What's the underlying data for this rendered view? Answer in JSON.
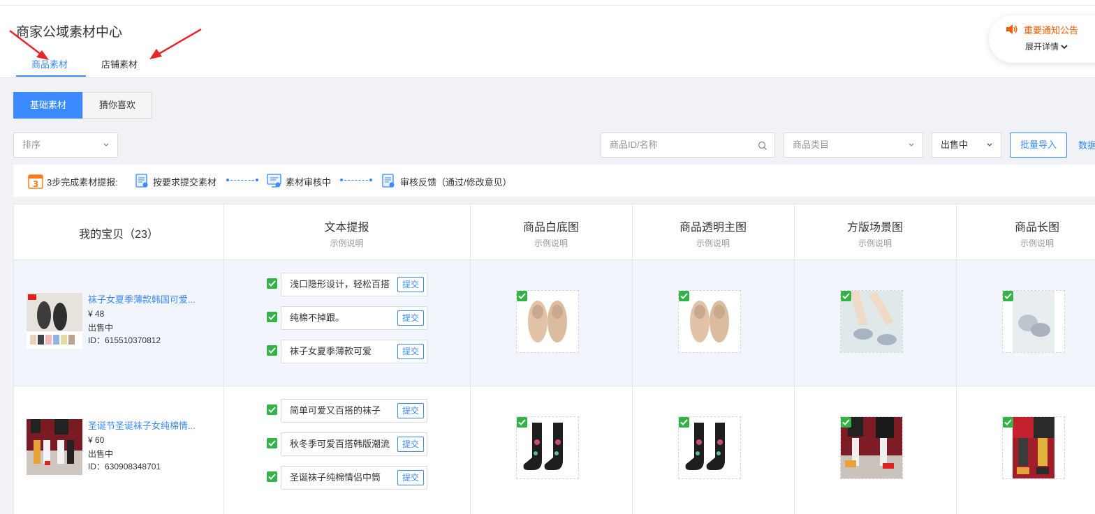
{
  "header": {
    "title": "商家公域素材中心",
    "tabs": [
      {
        "label": "商品素材",
        "active": true
      },
      {
        "label": "店铺素材",
        "active": false
      }
    ],
    "notice": {
      "title": "重要通知公告",
      "more": "展开详情"
    }
  },
  "segments": [
    {
      "label": "基础素材",
      "active": true
    },
    {
      "label": "猜你喜欢",
      "active": false
    }
  ],
  "filters": {
    "sort_placeholder": "排序",
    "search_placeholder": "商品ID/名称",
    "category_placeholder": "商品类目",
    "status_value": "出售中",
    "import_label": "批量导入",
    "data_link": "数据"
  },
  "steps": {
    "intro": "3步完成素材提报:",
    "step1": "按要求提交素材",
    "step2": "素材审核中",
    "step3": "审核反馈（通过/修改意见）"
  },
  "table": {
    "columns": [
      {
        "title": "我的宝贝（23）",
        "sub": ""
      },
      {
        "title": "文本提报",
        "sub": "示例说明"
      },
      {
        "title": "商品白底图",
        "sub": "示例说明"
      },
      {
        "title": "商品透明主图",
        "sub": "示例说明"
      },
      {
        "title": "方版场景图",
        "sub": "示例说明"
      },
      {
        "title": "商品长图",
        "sub": "示例说明"
      }
    ],
    "submit_label": "提交",
    "rows": [
      {
        "name": "袜子女夏季薄款韩国可爱...",
        "price": "¥ 48",
        "status": "出售中",
        "id": "ID：615510370812",
        "texts": [
          "浅口隐形设计，轻松百搭",
          "纯棉不掉跟。",
          "袜子女夏季薄款可爱"
        ]
      },
      {
        "name": "圣诞节圣诞袜子女纯棉情...",
        "price": "¥ 60",
        "status": "出售中",
        "id": "ID：630908348701",
        "texts": [
          "简单可爱又百搭的袜子",
          "秋冬季可爱百搭韩版潮流",
          "圣诞袜子纯棉情侣中筒"
        ]
      }
    ]
  },
  "colors": {
    "accent": "#3b8aff",
    "notice": "#ff5a00",
    "check": "#33b345"
  }
}
